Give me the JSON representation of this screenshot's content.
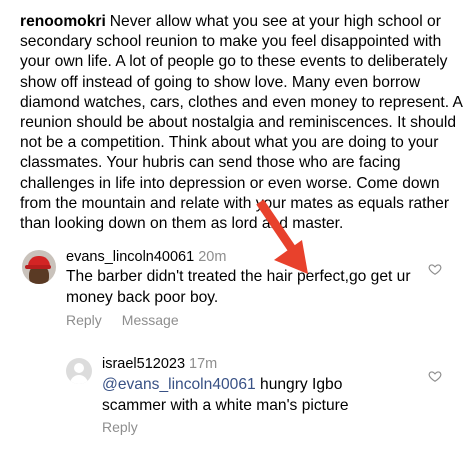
{
  "caption": {
    "username": "renoomokri",
    "text": "Never allow what you see at your high school or secondary school reunion to make you feel disappointed with your own life. A lot of people go to these events to deliberately show off instead of going to show love. Many even borrow diamond watches, cars, clothes and even money to represent. A reunion should be about nostalgia and reminiscences. It should not be a competition. Think about what you are doing to your classmates. Your hubris can send those who are facing challenges in life into depression or even worse. Come down from the mountain and relate with your mates as equals rather than looking down on them as lord and master."
  },
  "comments": [
    {
      "username": "evans_lincoln40061",
      "time": "20m",
      "text": "The barber didn't treated the hair perfect,go get ur money back poor boy.",
      "actions": [
        "Reply",
        "Message"
      ],
      "like_icon": "heart-outline-icon"
    }
  ],
  "replies": [
    {
      "username": "israel512023",
      "time": "17m",
      "mention": "@evans_lincoln40061",
      "text": " hungry Igbo scammer with a white man's picture",
      "actions": [
        "Reply"
      ],
      "like_icon": "heart-outline-icon"
    }
  ],
  "annotation": {
    "arrow_icon": "red-arrow-icon",
    "arrow_color": "#e8412c"
  },
  "colors": {
    "secondary_text": "#8e8e8e",
    "mention": "#385185"
  }
}
